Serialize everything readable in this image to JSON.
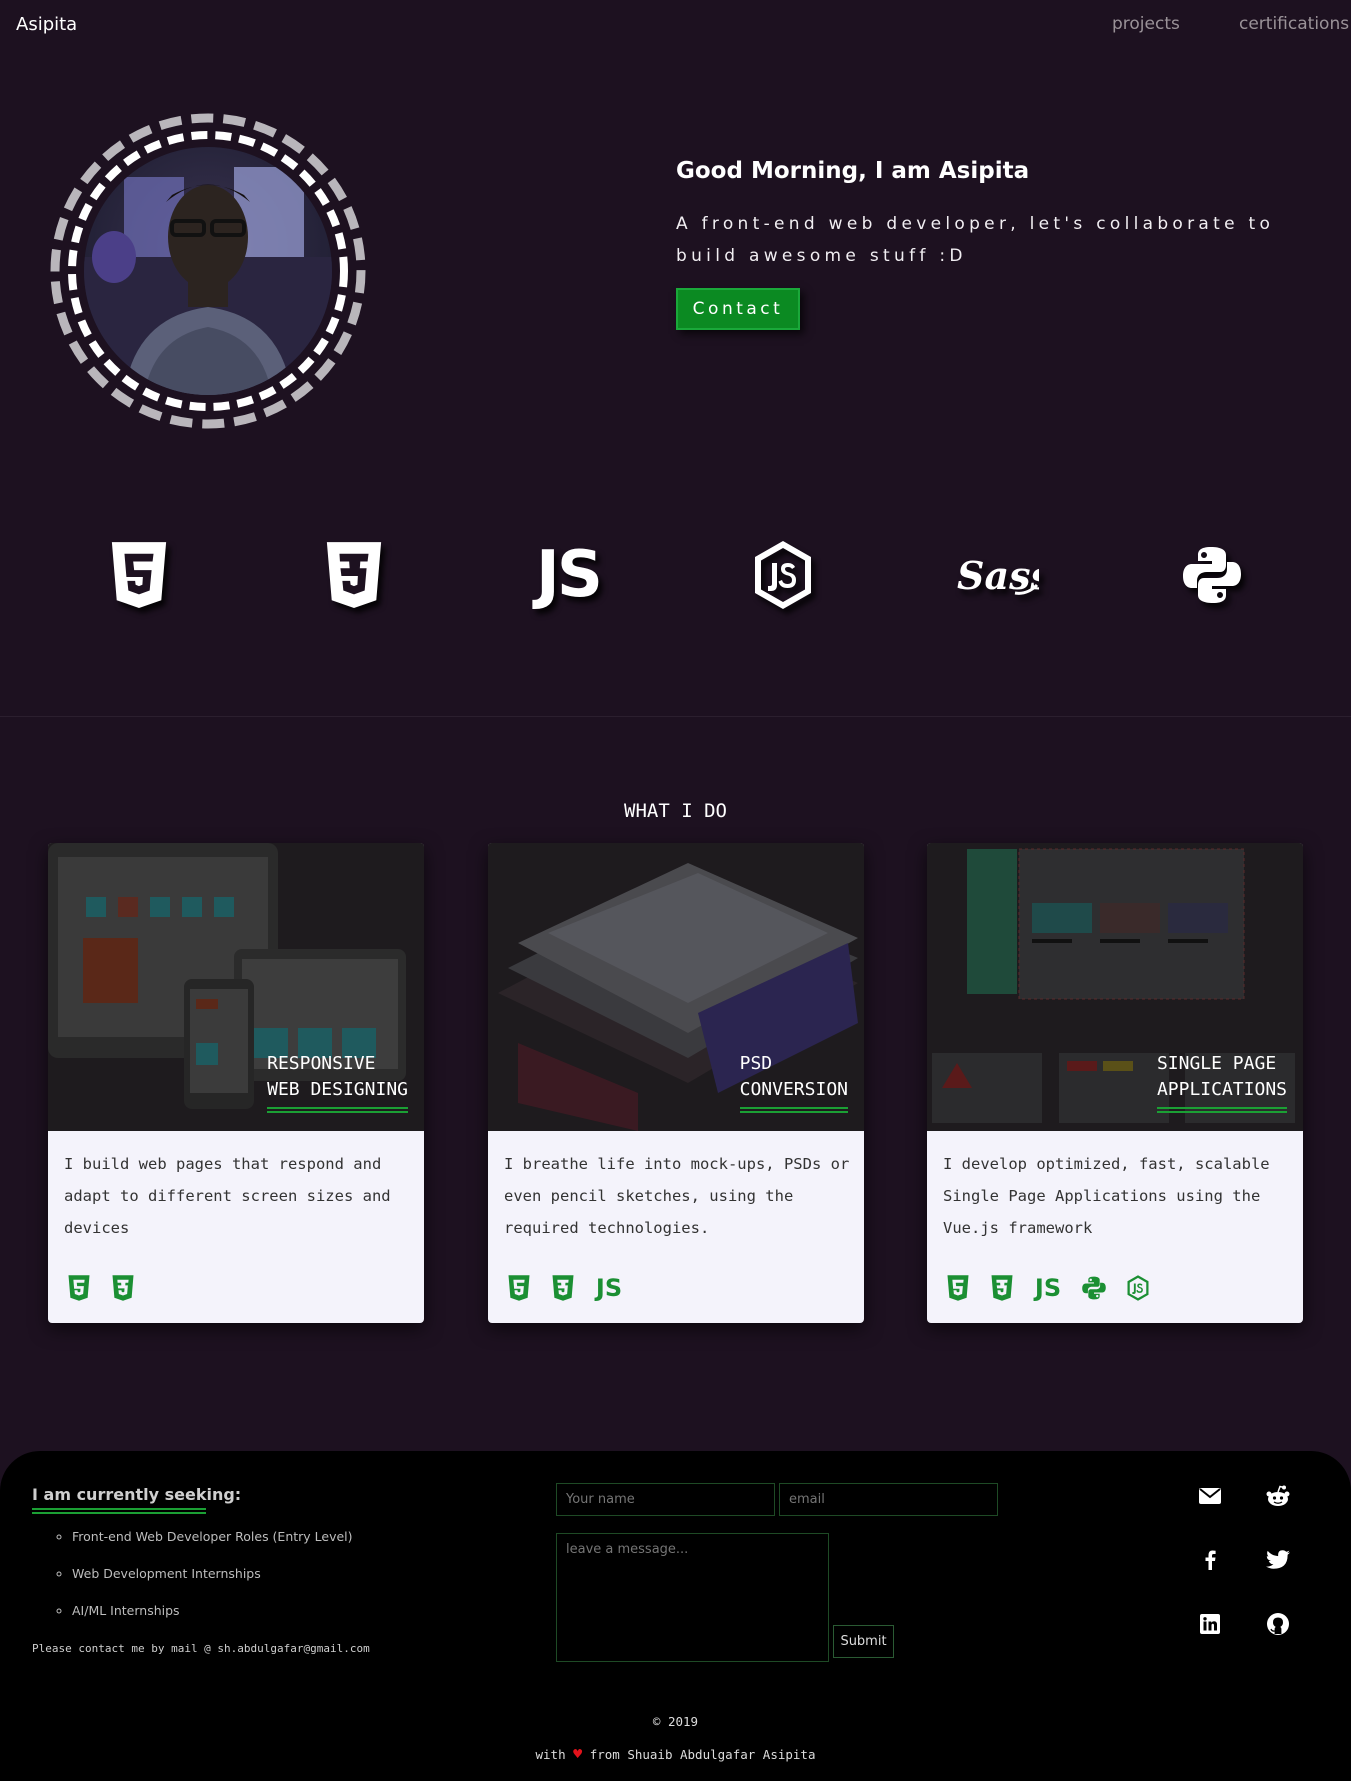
{
  "nav": {
    "brand": "Asipita",
    "links": [
      "projects",
      "certifications"
    ]
  },
  "hero": {
    "greeting": "Good Morning, I am Asipita",
    "tagline": "A front-end web developer, let's collaborate to build awesome stuff :D",
    "contact_label": "Contact"
  },
  "tech_icons": [
    "html5-icon",
    "css3-icon",
    "javascript-icon",
    "nodejs-icon",
    "sass-icon",
    "python-icon"
  ],
  "services": {
    "title": "WHAT I DO",
    "cards": [
      {
        "title_line1": "RESPONSIVE",
        "title_line2": "WEB DESIGNING",
        "description": "I build web pages that respond and adapt to different screen sizes and devices",
        "icons": [
          "html5-icon",
          "css3-icon"
        ]
      },
      {
        "title_line1": "PSD",
        "title_line2": "CONVERSION",
        "description": "I breathe life into mock-ups, PSDs or even pencil sketches, using the required technologies.",
        "icons": [
          "html5-icon",
          "css3-icon",
          "javascript-icon"
        ]
      },
      {
        "title_line1": "SINGLE PAGE",
        "title_line2": "APPLICATIONS",
        "description": "I develop optimized, fast, scalable Single Page Applications using the Vue.js framework",
        "icons": [
          "html5-icon",
          "css3-icon",
          "javascript-icon",
          "python-icon",
          "nodejs-icon"
        ]
      }
    ]
  },
  "footer": {
    "seeking_title": "I am currently seeking:",
    "seeking_items": [
      "Front-end Web Developer Roles (Entry Level)",
      "Web Development Internships",
      "AI/ML Internships"
    ],
    "contact_note": "Please contact me by mail @ sh.abdulgafar@gmail.com",
    "form": {
      "name_placeholder": "Your name",
      "email_placeholder": "email",
      "message_placeholder": "leave a message...",
      "submit_label": "Submit"
    },
    "social_icons": [
      "mail-icon",
      "reddit-icon",
      "facebook-icon",
      "twitter-icon",
      "linkedin-icon",
      "github-icon"
    ],
    "copyright": "© 2019",
    "credit_prefix": "with",
    "credit_suffix": "from Shuaib Abdulgafar Asipita"
  },
  "colors": {
    "background": "#1d1120",
    "accent": "#0b8a22",
    "footer_bg": "#000000",
    "card_bg": "#f4f3fb",
    "heart": "#e3121b"
  }
}
